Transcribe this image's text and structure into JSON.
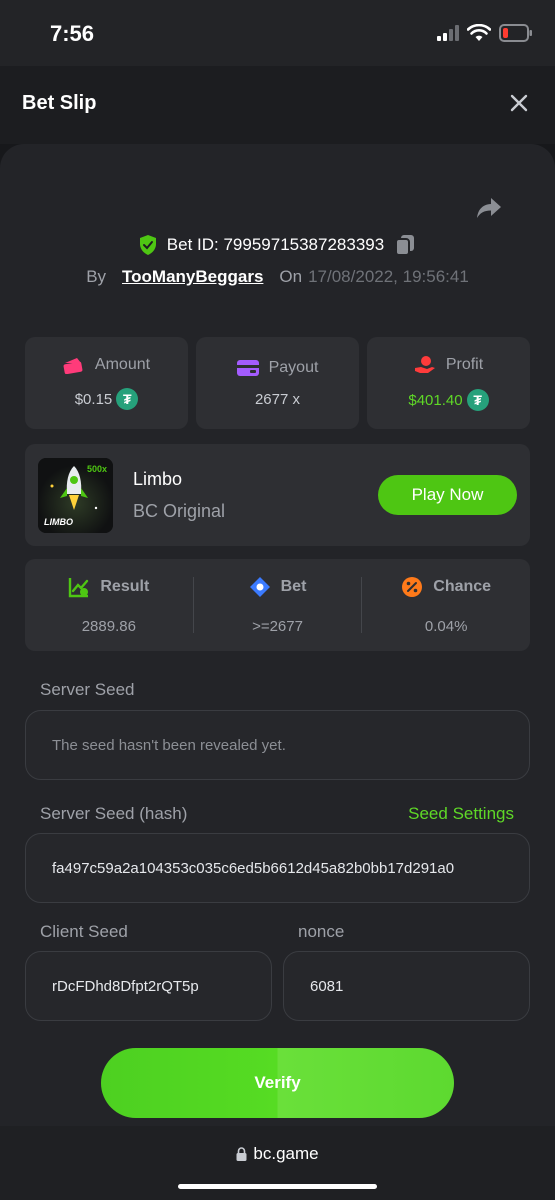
{
  "status": {
    "time": "7:56"
  },
  "header": {
    "title": "Bet Slip"
  },
  "bet": {
    "id_label": "Bet ID: 79959715387283393",
    "by_label": "By",
    "user": "TooManyBeggars",
    "on_label": "On",
    "date": "17/08/2022, 19:56:41"
  },
  "stats": {
    "amount": {
      "label": "Amount",
      "value": "$0.15"
    },
    "payout": {
      "label": "Payout",
      "value": "2677 x"
    },
    "profit": {
      "label": "Profit",
      "value": "$401.40"
    }
  },
  "game": {
    "name": "Limbo",
    "provider": "BC Original",
    "thumb_text": "LIMBO",
    "thumb_badge": "500x",
    "play_label": "Play Now"
  },
  "result": {
    "result": {
      "label": "Result",
      "value": "2889.86"
    },
    "bet": {
      "label": "Bet",
      "value": ">=2677"
    },
    "chance": {
      "label": "Chance",
      "value": "0.04%"
    }
  },
  "seeds": {
    "server_seed_label": "Server Seed",
    "server_seed_value": "The seed hasn't been revealed yet.",
    "server_hash_label": "Server Seed (hash)",
    "seed_settings_label": "Seed Settings",
    "server_hash_value": "fa497c59a2a104353c035c6ed5b6612d45a82b0bb17d291a0",
    "client_seed_label": "Client Seed",
    "client_seed_value": "rDcFDhd8Dfpt2rQT5p",
    "nonce_label": "nonce",
    "nonce_value": "6081"
  },
  "verify_label": "Verify",
  "browser": {
    "url": "bc.game"
  },
  "colors": {
    "accent_green": "#5fd827",
    "tether": "#26a17b"
  }
}
